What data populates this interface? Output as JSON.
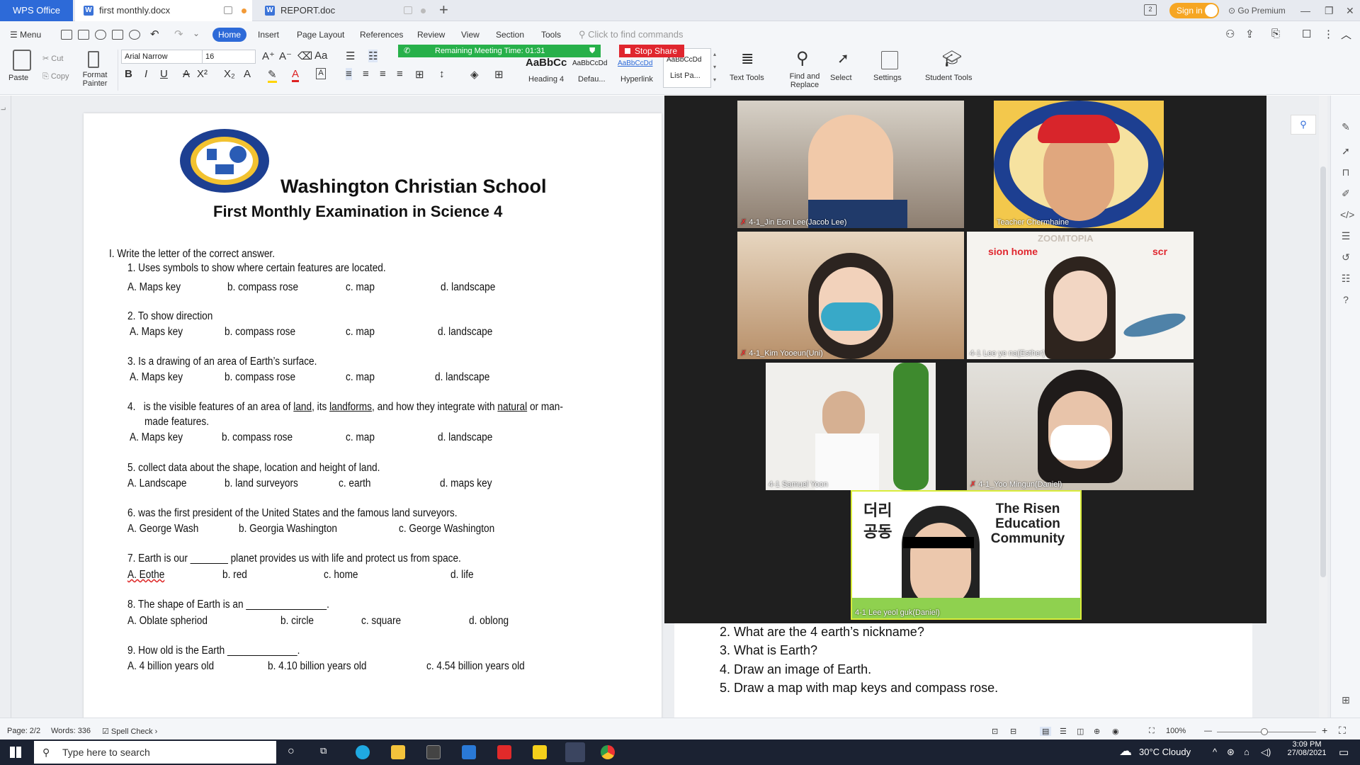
{
  "tabs": {
    "app": "WPS Office",
    "doc1": "first monthly.docx",
    "doc2": "REPORT.doc",
    "signin": "Sign in",
    "premium": "Go Premium"
  },
  "menu": {
    "menu_label": "Menu",
    "items": [
      "Home",
      "Insert",
      "Page Layout",
      "References",
      "Review",
      "View",
      "Section",
      "Tools"
    ],
    "find_placeholder": "Click to find commands"
  },
  "ribbon": {
    "paste": "Paste",
    "cut": "Cut",
    "copy": "Copy",
    "format_painter": "Format Painter",
    "font_name": "Arial Narrow",
    "font_size": "16",
    "styles": [
      {
        "preview": "AaBbCc",
        "label": "Heading 4"
      },
      {
        "preview": "AaBbCcDd",
        "label": "Defau..."
      },
      {
        "preview": "AaBbCcDd",
        "label": "Hyperlink"
      },
      {
        "preview": "AaBbCcDd",
        "label": "List Pa..."
      }
    ],
    "text_tools": "Text Tools",
    "find_replace": "Find and Replace",
    "select": "Select",
    "settings": "Settings",
    "student_tools": "Student Tools"
  },
  "meeting": {
    "remaining": "Remaining Meeting Time: 01:31",
    "stop_share": "Stop Share"
  },
  "document": {
    "school": "Washington Christian School",
    "exam_title": "First Monthly Examination in Science 4",
    "section": "I.  Write the letter of the correct answer.",
    "questions": [
      {
        "q": "1.   Uses symbols to show where certain features are located.",
        "a": "A. Maps key",
        "b": "b. compass rose",
        "c": "c. map",
        "d": "d. landscape"
      },
      {
        "q": "2.   To show direction",
        "a": "A. Maps key",
        "b": "b. compass rose",
        "c": "c. map",
        "d": "d. landscape"
      },
      {
        "q": "3.   Is a drawing of an area of Earth’s surface.",
        "a": "A. Maps key",
        "b": "b. compass rose",
        "c": "c. map",
        "d": "d. landscape"
      },
      {
        "q": "5.   collect data about the shape, location and height of land.",
        "a": "A. Landscape",
        "b": "b. land surveyors",
        "c": "c. earth",
        "d": "d. maps key"
      },
      {
        "q": "6.    was the first president of the United States and the famous land surveyors.",
        "a": "A. George Wash",
        "b": "b. Georgia Washington",
        "c": "c. George Washington",
        "d": ""
      },
      {
        "q": "7.   Earth is our _______ planet provides us with life and protect us from space.",
        "a": "A. Eothe",
        "b": "b. red",
        "c": "c. home",
        "d": "d. life"
      },
      {
        "q": "8.   The shape of Earth is an _______________.",
        "a": "A. Oblate spheriod",
        "b": "b. circle",
        "c": "c. square",
        "d": "d.  oblong"
      },
      {
        "q": "9.   How old is the Earth _____________.",
        "a": "A. 4 billion years old",
        "b": "b. 4.10 billion years old",
        "c": "c. 4.54 billion years old",
        "d": ""
      }
    ],
    "q4": {
      "num": "4.",
      "p1": "is the visible features of an area of ",
      "w1": "land",
      "p2": ", its ",
      "w2": "landforms",
      "p3": ", and how they integrate with ",
      "w3": "natural",
      "p4": " or man-",
      "line2": "made features.",
      "a": "A. Maps key",
      "b": "b. compass rose",
      "c": "c. map",
      "d": "d. landscape"
    }
  },
  "page2": {
    "items": [
      "2.  What are the 4 earth’s nickname?",
      "3.  What is Earth?",
      "4.  Draw an image of Earth.",
      "5.  Draw a map with map keys and compass rose."
    ]
  },
  "zoom": {
    "participants": [
      "4-1_Jin Eon Lee(Jacob Lee)",
      "Teacher Chermhaine",
      "4-1_Kim Yooeun(Uni)",
      "4-1 Lee ye na(Esther)",
      "4-1 Samuel Yoon",
      "4-1_Yoo Mingun(Daniel)",
      "4-1 Lee yeol guk(Daniel)"
    ],
    "zootopia_text": "ZOOMTOPIA",
    "sion_home": "sion home",
    "scr": "scr",
    "risen": "The Risen Education Community",
    "korean": "더리\n공동"
  },
  "status": {
    "page": "Page: 2/2",
    "words": "Words: 336",
    "spell": "Spell Check",
    "zoom": "100%"
  },
  "taskbar": {
    "search": "Type here to search",
    "weather": "30°C  Cloudy",
    "time": "3:09 PM",
    "date": "27/08/2021"
  }
}
